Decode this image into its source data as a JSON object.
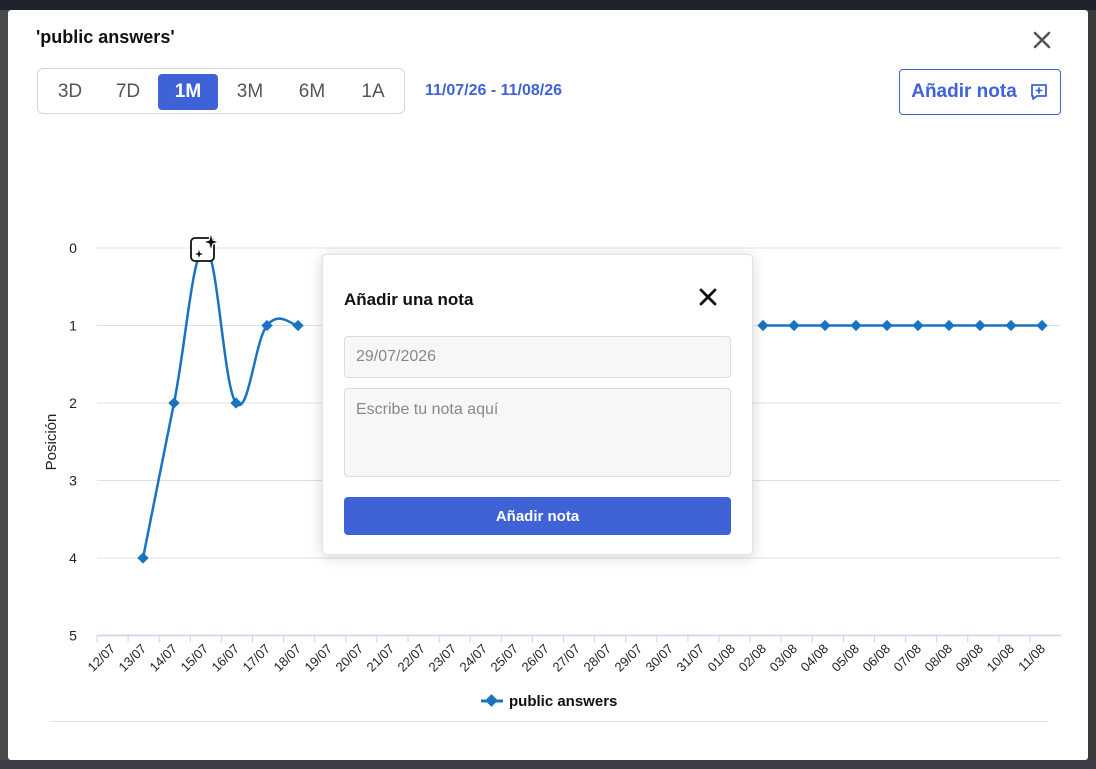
{
  "modal": {
    "title": "'public answers'",
    "close_icon": "close-icon"
  },
  "range_buttons": [
    {
      "label": "3D",
      "active": false
    },
    {
      "label": "7D",
      "active": false
    },
    {
      "label": "1M",
      "active": true
    },
    {
      "label": "3M",
      "active": false
    },
    {
      "label": "6M",
      "active": false
    },
    {
      "label": "1A",
      "active": false
    }
  ],
  "date_range": "11/07/26 - 11/08/26",
  "add_note_button": {
    "label": "Añadir nota",
    "icon": "comment-plus-icon"
  },
  "colors": {
    "accent": "#3f63d6",
    "series": "#1a73c0",
    "grid": "#e0e0e0"
  },
  "chart_data": {
    "type": "line",
    "ylabel": "Posición",
    "y_ticks": [
      "0",
      "1",
      "2",
      "3",
      "4",
      "5"
    ],
    "ylim": [
      0,
      5
    ],
    "y_inverted": true,
    "categories": [
      "12/07",
      "13/07",
      "14/07",
      "15/07",
      "16/07",
      "17/07",
      "18/07",
      "19/07",
      "20/07",
      "21/07",
      "22/07",
      "23/07",
      "24/07",
      "25/07",
      "26/07",
      "27/07",
      "28/07",
      "29/07",
      "30/07",
      "31/07",
      "01/08",
      "02/08",
      "03/08",
      "04/08",
      "05/08",
      "06/08",
      "07/08",
      "08/08",
      "09/08",
      "10/08",
      "11/08"
    ],
    "series": [
      {
        "name": "public answers",
        "values": [
          null,
          4,
          2,
          0,
          2,
          1,
          1,
          null,
          null,
          null,
          null,
          null,
          null,
          null,
          null,
          null,
          null,
          null,
          null,
          null,
          null,
          1,
          1,
          1,
          1,
          1,
          1,
          1,
          1,
          1,
          1
        ]
      }
    ],
    "annotation": {
      "category": "15/07",
      "icon": "sparkle-note-icon"
    },
    "legend": "bottom-center"
  },
  "popup": {
    "title": "Añadir una nota",
    "date_value": "29/07/2026",
    "note_placeholder": "Escribe tu nota aquí",
    "submit_label": "Añadir nota"
  }
}
